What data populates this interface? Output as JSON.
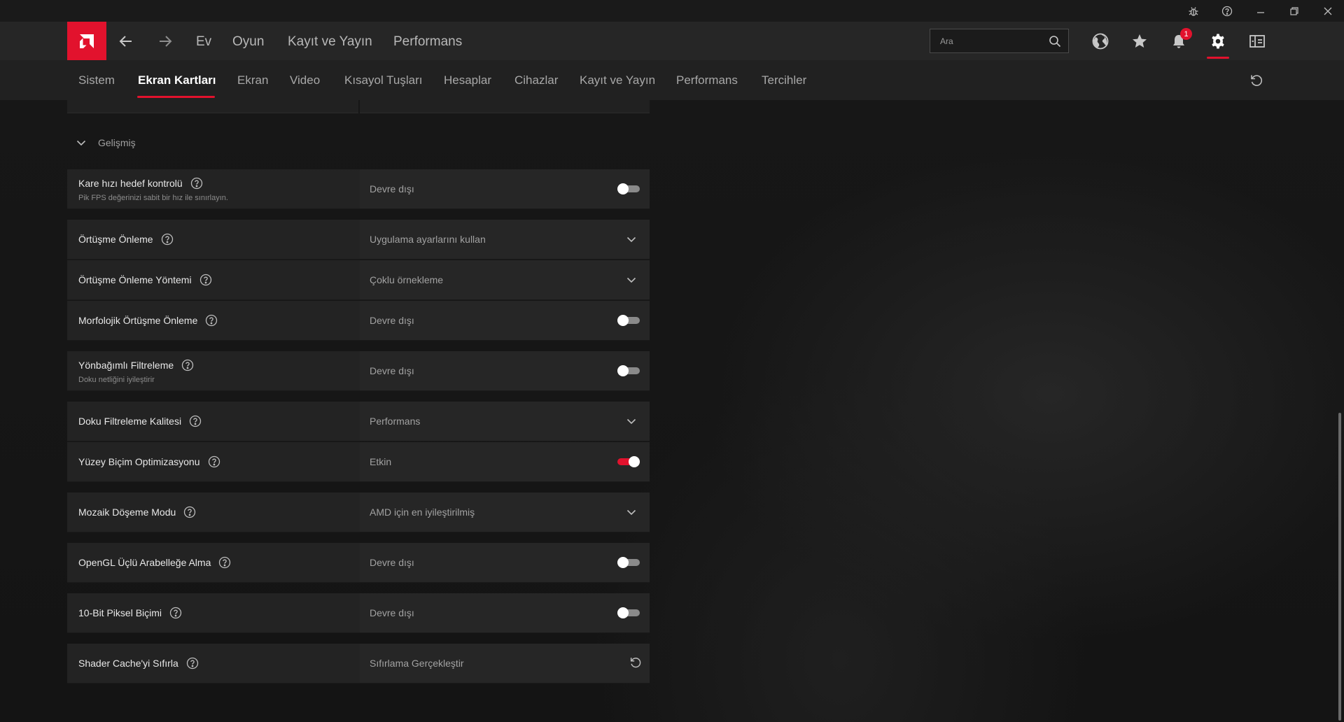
{
  "colors": {
    "accent": "#e2122d",
    "background": "#141414",
    "row_bg": "#232323",
    "header_bg": "#262626"
  },
  "titlebar": {
    "icons": [
      "bug-icon",
      "help-circle-icon",
      "minimize-icon",
      "restore-icon",
      "close-icon"
    ]
  },
  "header": {
    "logo_icon": "amd-logo-icon",
    "nav": [
      "Ev",
      "Oyun",
      "Kayıt ve Yayın",
      "Performans"
    ],
    "search_placeholder": "Ara",
    "notification_count": "1",
    "icons": [
      "globe-icon",
      "star-icon",
      "bell-icon",
      "gear-icon",
      "sidebar-panel-icon"
    ]
  },
  "subnav": {
    "tabs": [
      "Sistem",
      "Ekran Kartları",
      "Ekran",
      "Video",
      "Kısayol Tuşları",
      "Hesaplar",
      "Cihazlar",
      "Kayıt ve Yayın",
      "Performans",
      "Tercihler"
    ],
    "active": "Ekran Kartları"
  },
  "section": {
    "title": "Gelişmiş"
  },
  "settings": [
    {
      "label": "Kare hızı hedef kontrolü",
      "desc": "Pik FPS değerinizi sabit bir hız ile sınırlayın.",
      "value": "Devre dışı",
      "control": "toggle",
      "state": "off"
    },
    {
      "label": "Örtüşme Önleme",
      "value": "Uygulama ayarlarını kullan",
      "control": "dropdown"
    },
    {
      "label": "Örtüşme Önleme Yöntemi",
      "value": "Çoklu örnekleme",
      "control": "dropdown"
    },
    {
      "label": "Morfolojik Örtüşme Önleme",
      "value": "Devre dışı",
      "control": "toggle",
      "state": "off"
    },
    {
      "label": "Yönbağımlı Filtreleme",
      "desc": "Doku netliğini iyileştirir",
      "value": "Devre dışı",
      "control": "toggle",
      "state": "off"
    },
    {
      "label": "Doku Filtreleme Kalitesi",
      "value": "Performans",
      "control": "dropdown"
    },
    {
      "label": "Yüzey Biçim Optimizasyonu",
      "value": "Etkin",
      "control": "toggle",
      "state": "on"
    },
    {
      "label": "Mozaik Döşeme Modu",
      "value": "AMD için en iyileştirilmiş",
      "control": "dropdown"
    },
    {
      "label": "OpenGL Üçlü Arabelleğe Alma",
      "value": "Devre dışı",
      "control": "toggle",
      "state": "off"
    },
    {
      "label": "10-Bit Piksel Biçimi",
      "value": "Devre dışı",
      "control": "toggle",
      "state": "off"
    },
    {
      "label": "Shader Cache'yi Sıfırla",
      "value": "Sıfırlama Gerçekleştir",
      "control": "reset"
    }
  ]
}
